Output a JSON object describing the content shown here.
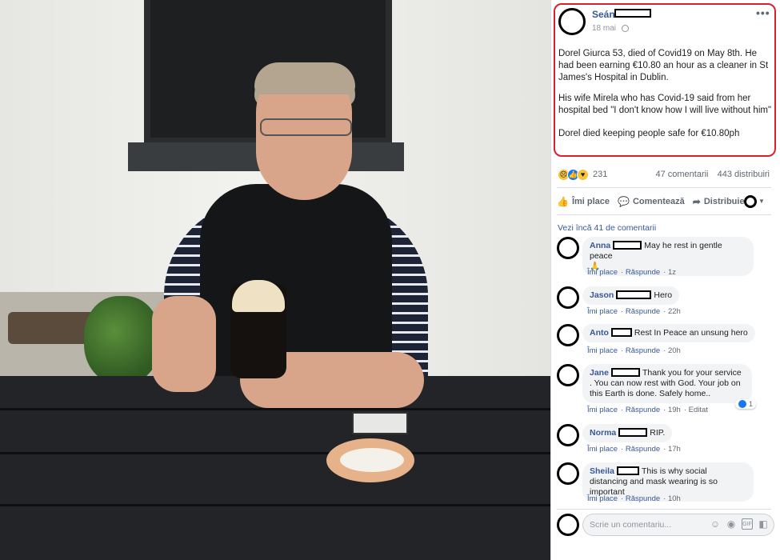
{
  "post": {
    "author": "Seán",
    "date": "18 mai",
    "more": "•••",
    "paragraphs": [
      "Dorel Giurca 53, died of Covid19 on May 8th. He had been earning €10.80 an hour as a cleaner in St James's Hospital in Dublin.",
      "His wife Mirela who has Covid-19 said from her hospital bed \"I don't know how I will live without him\"",
      "Dorel died keeping people safe for €10.80ph"
    ],
    "highlight_color": "#d9202f"
  },
  "stats": {
    "reaction_count": "231",
    "comments": "47 comentarii",
    "shares": "443 distribuiri"
  },
  "actions": {
    "like": "Îmi place",
    "comment": "Comentează",
    "share": "Distribuie"
  },
  "see_more": "Vezi încă 41 de comentarii",
  "comments": [
    {
      "name": "Anna",
      "text": "May he rest in gentle peace",
      "emoji": "🙏",
      "like": "Îmi place",
      "reply": "Răspunde",
      "time": "1z"
    },
    {
      "name": "Jason",
      "text": "Hero",
      "like": "Îmi place",
      "reply": "Răspunde",
      "time": "22h"
    },
    {
      "name": "Anto",
      "text": "Rest In Peace an unsung hero",
      "like": "Îmi place",
      "reply": "Răspunde",
      "time": "20h"
    },
    {
      "name": "Jane",
      "text": "Thank you for your service . You can now rest with God. Your job on this Earth is done. Safely home..",
      "like": "Îmi place",
      "reply": "Răspunde",
      "time": "19h",
      "edited": "Editat",
      "likes": "1"
    },
    {
      "name": "Norma",
      "text": "RIP.",
      "like": "Îmi place",
      "reply": "Răspunde",
      "time": "17h"
    },
    {
      "name": "Sheila",
      "text": "This is why social distancing and mask wearing is so important",
      "like": "Îmi place",
      "reply": "Răspunde",
      "time": "10h"
    }
  ],
  "composer": {
    "placeholder": "Scrie un comentariu..."
  },
  "icons": {
    "globe": "globe-icon",
    "like": "thumbs-up-icon",
    "comment": "speech-bubble-icon",
    "share": "share-arrow-icon",
    "emoji": "smiley-icon",
    "camera": "camera-icon",
    "gif": "gif-icon",
    "sticker": "sticker-icon"
  },
  "colors": {
    "link": "#385898",
    "muted": "#606770",
    "like_blue": "#1877f2"
  }
}
